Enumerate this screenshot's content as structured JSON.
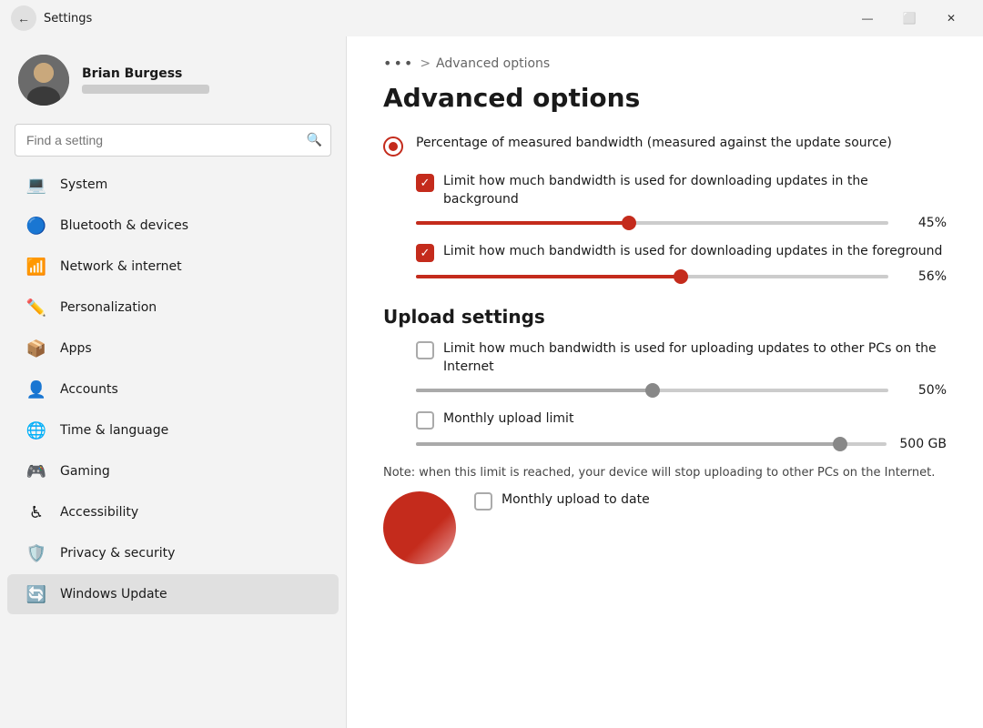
{
  "titleBar": {
    "title": "Settings",
    "controls": {
      "minimize": "—",
      "maximize": "⬜",
      "close": "✕"
    }
  },
  "sidebar": {
    "user": {
      "name": "Brian Burgess",
      "email": "••••••••••"
    },
    "search": {
      "placeholder": "Find a setting",
      "icon": "🔍"
    },
    "navItems": [
      {
        "id": "system",
        "label": "System",
        "icon": "💻",
        "active": false
      },
      {
        "id": "bluetooth",
        "label": "Bluetooth & devices",
        "icon": "🔵",
        "active": false
      },
      {
        "id": "network",
        "label": "Network & internet",
        "icon": "📶",
        "active": false
      },
      {
        "id": "personalization",
        "label": "Personalization",
        "icon": "✏️",
        "active": false
      },
      {
        "id": "apps",
        "label": "Apps",
        "icon": "📦",
        "active": false
      },
      {
        "id": "accounts",
        "label": "Accounts",
        "icon": "👤",
        "active": false
      },
      {
        "id": "time",
        "label": "Time & language",
        "icon": "🌐",
        "active": false
      },
      {
        "id": "gaming",
        "label": "Gaming",
        "icon": "🎮",
        "active": false
      },
      {
        "id": "accessibility",
        "label": "Accessibility",
        "icon": "♿",
        "active": false
      },
      {
        "id": "privacy",
        "label": "Privacy & security",
        "icon": "🛡️",
        "active": false
      },
      {
        "id": "windowsupdate",
        "label": "Windows Update",
        "icon": "🔄",
        "active": true
      }
    ]
  },
  "main": {
    "breadcrumb": {
      "dots": "•••",
      "separator": ">",
      "title": "Advanced options"
    },
    "pageTitle": "Advanced options",
    "radioOption": {
      "label": "Percentage of measured bandwidth (measured against the update source)"
    },
    "downloadSettings": {
      "background": {
        "checked": true,
        "label": "Limit how much bandwidth is used for downloading updates in the background",
        "sliderValue": "45%",
        "sliderPercent": 45
      },
      "foreground": {
        "checked": true,
        "label": "Limit how much bandwidth is used for downloading updates in the foreground",
        "sliderValue": "56%",
        "sliderPercent": 56
      }
    },
    "uploadSettings": {
      "sectionTitle": "Upload settings",
      "uploadToInternet": {
        "checked": false,
        "label": "Limit how much bandwidth is used for uploading updates to other PCs on the Internet",
        "sliderValue": "50%",
        "sliderPercent": 50
      },
      "monthlyUploadLimit": {
        "checked": false,
        "label": "Monthly upload limit",
        "sliderValue": "500 GB",
        "sliderPercent": 90
      },
      "note": "Note: when this limit is reached, your device will stop uploading to other PCs on the Internet.",
      "monthlyUploadToDate": {
        "label": "Monthly upload to date"
      }
    }
  }
}
